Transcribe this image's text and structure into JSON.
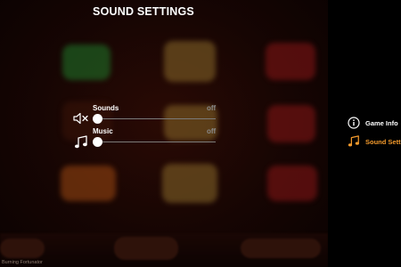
{
  "title": "SOUND SETTINGS",
  "sounds": {
    "label": "Sounds",
    "state": "off",
    "level": 0,
    "icon": "speaker-muted-icon"
  },
  "music": {
    "label": "Music",
    "state": "off",
    "level": 0,
    "icon": "music-note-icon"
  },
  "menu": [
    {
      "label": "Game Info",
      "icon": "info-icon",
      "active": false
    },
    {
      "label": "Sound Settings",
      "icon": "music-note-icon",
      "active": true
    }
  ],
  "footer": "Burning Fortunator",
  "colors": {
    "accent": "#f39a2c",
    "track": "#7a7a7a",
    "background": "#000000"
  }
}
